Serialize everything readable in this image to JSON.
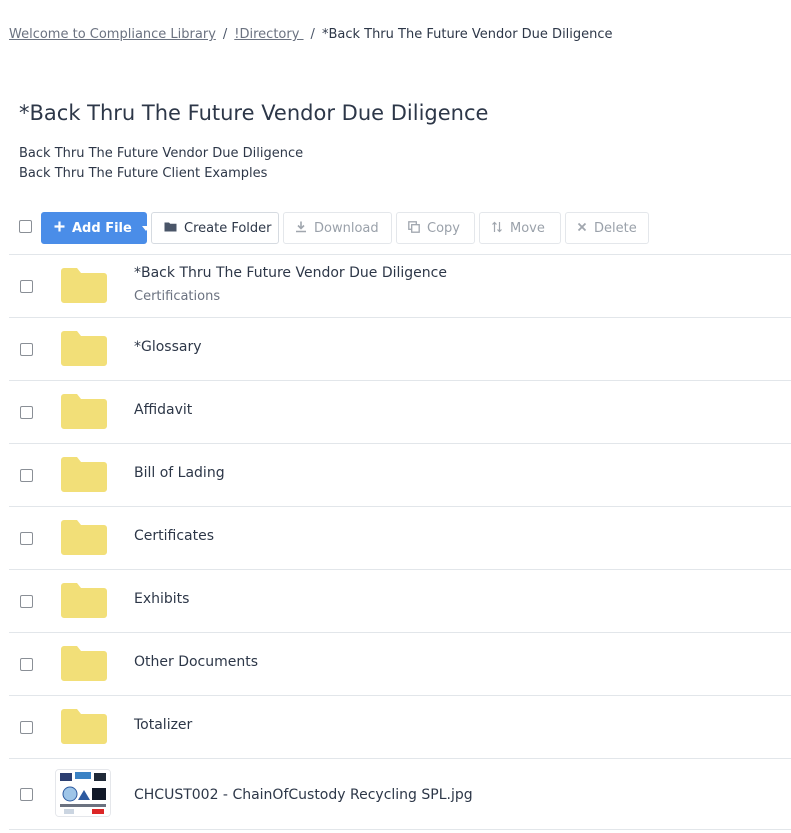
{
  "breadcrumb": {
    "items": [
      "Welcome to Compliance Library",
      "!Directory "
    ],
    "separator": "/",
    "current": "*Back Thru The Future Vendor Due Diligence"
  },
  "page": {
    "title": "*Back Thru The Future Vendor Due Diligence",
    "description_lines": [
      "Back Thru The Future Vendor Due Diligence",
      "Back Thru The Future Client Examples"
    ]
  },
  "toolbar": {
    "add_file_label": "Add File",
    "create_folder_label": "Create Folder",
    "download_label": "Download",
    "copy_label": "Copy",
    "move_label": "Move",
    "delete_label": "Delete",
    "icons": {
      "add": "plus-icon",
      "folder": "folder-icon",
      "download": "download-icon",
      "copy": "copy-icon",
      "move": "move-icon",
      "delete": "close-icon"
    }
  },
  "colors": {
    "primary": "#4a8de8",
    "folder": "#f2df78",
    "text": "#2d3748",
    "muted": "#6b7280"
  },
  "items": [
    {
      "type": "folder",
      "name": "*Back Thru The Future Vendor Due Diligence",
      "subtitle": "Certifications"
    },
    {
      "type": "folder",
      "name": "*Glossary"
    },
    {
      "type": "folder",
      "name": "Affidavit"
    },
    {
      "type": "folder",
      "name": "Bill of Lading"
    },
    {
      "type": "folder",
      "name": "Certificates"
    },
    {
      "type": "folder",
      "name": "Exhibits"
    },
    {
      "type": "folder",
      "name": "Other Documents"
    },
    {
      "type": "folder",
      "name": "Totalizer"
    },
    {
      "type": "image",
      "name": "CHCUST002 - ChainOfCustody Recycling SPL.jpg"
    }
  ]
}
